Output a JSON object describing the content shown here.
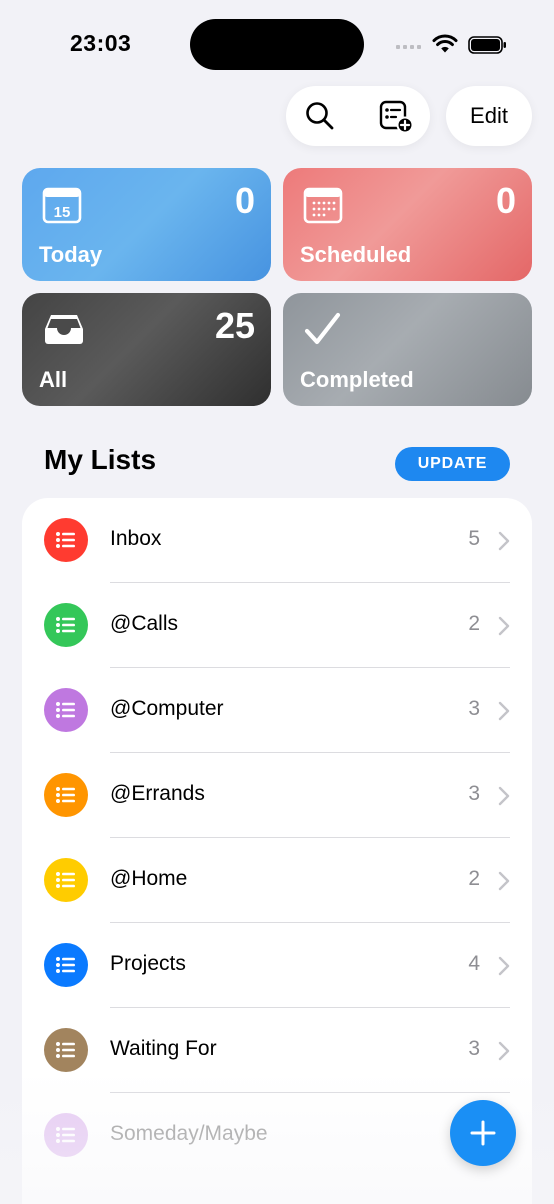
{
  "status_bar": {
    "time": "23:03",
    "icons": [
      "cellular-signal-icon",
      "wifi-icon",
      "battery-icon"
    ]
  },
  "toolbar": {
    "search_icon": "search-icon",
    "add_list_icon": "add-list-icon",
    "edit_label": "Edit"
  },
  "smart_lists": {
    "today": {
      "label": "Today",
      "count": "0",
      "icon": "calendar-15-icon",
      "color": "#5ea8ee",
      "calendar_day": "15"
    },
    "scheduled": {
      "label": "Scheduled",
      "count": "0",
      "icon": "calendar-grid-icon",
      "color": "#ed7a7a"
    },
    "all": {
      "label": "All",
      "count": "25",
      "icon": "inbox-tray-icon",
      "color": "#444444"
    },
    "completed": {
      "label": "Completed",
      "icon": "checkmark-icon",
      "color": "#9aa0a5"
    }
  },
  "my_lists": {
    "title": "My Lists",
    "update_label": "UPDATE",
    "items": [
      {
        "name": "Inbox",
        "count": "5",
        "color": "#ff3b30"
      },
      {
        "name": "@Calls",
        "count": "2",
        "color": "#34c759"
      },
      {
        "name": "@Computer",
        "count": "3",
        "color": "#bf78e0"
      },
      {
        "name": "@Errands",
        "count": "3",
        "color": "#ff9500"
      },
      {
        "name": "@Home",
        "count": "2",
        "color": "#ffcc00"
      },
      {
        "name": "Projects",
        "count": "4",
        "color": "#0a7aff"
      },
      {
        "name": "Waiting For",
        "count": "3",
        "color": "#a2845e"
      },
      {
        "name": "Someday/Maybe",
        "count": "",
        "color": "#bf78e0"
      }
    ]
  },
  "fab": {
    "icon": "plus-icon",
    "color": "#1a8ff5"
  }
}
